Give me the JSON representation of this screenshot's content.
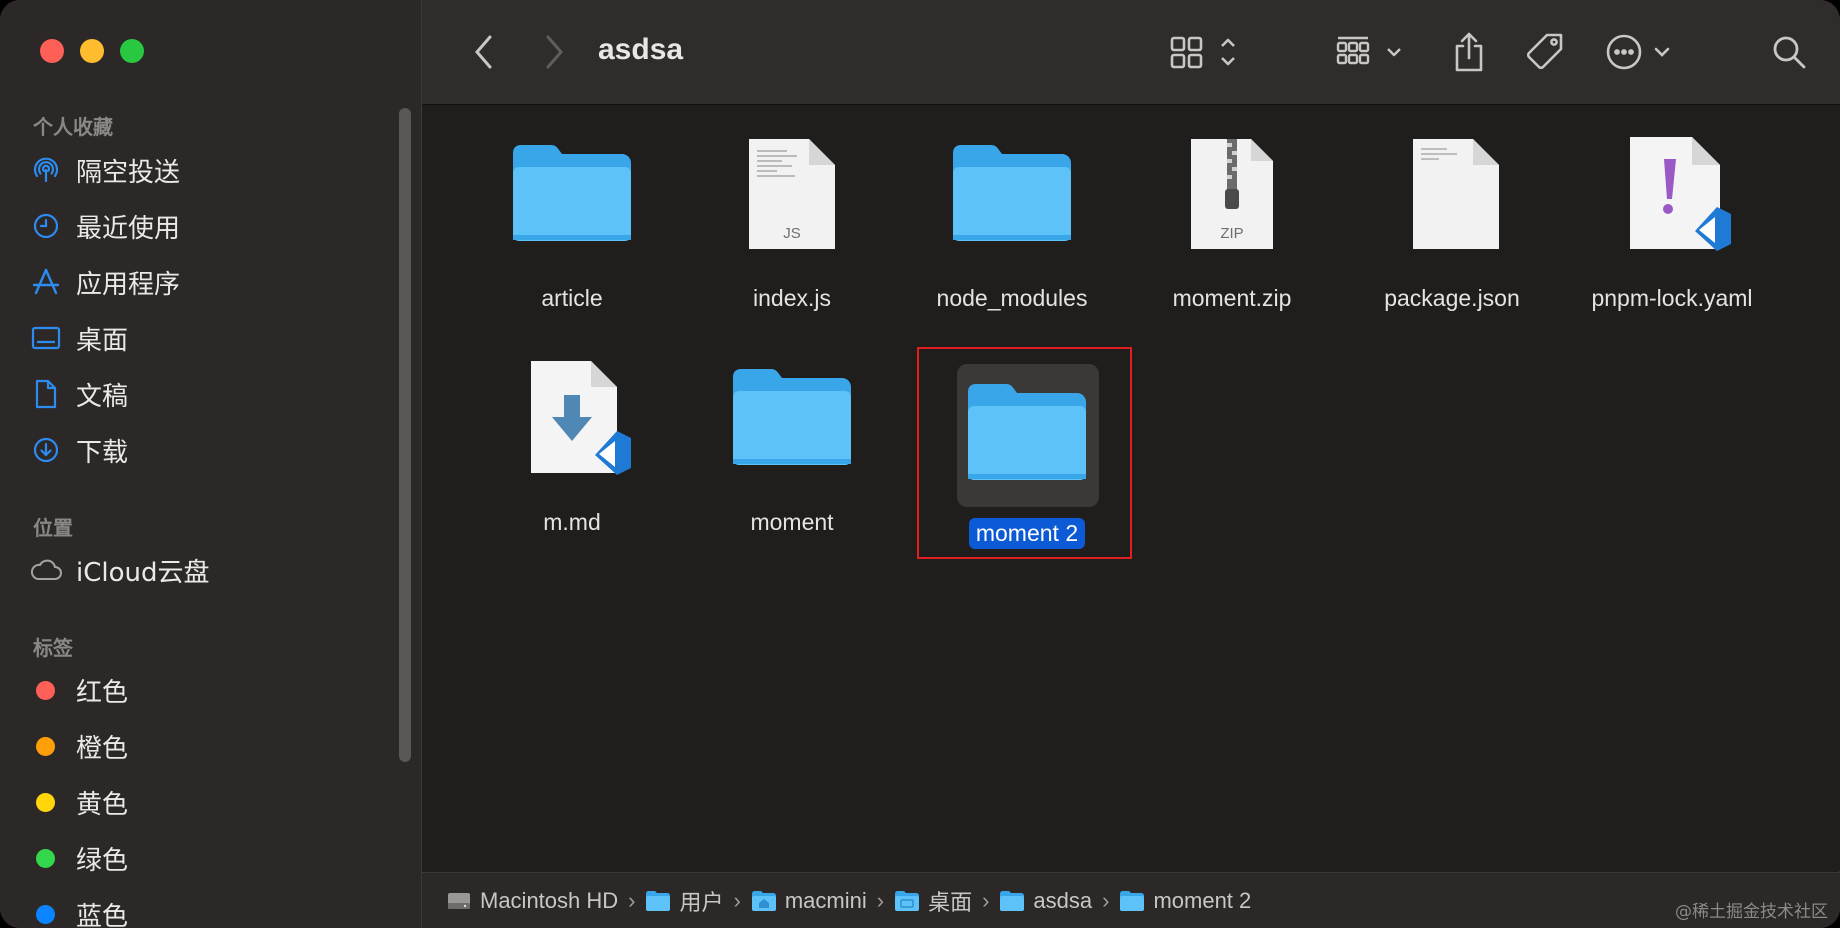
{
  "window": {
    "title": "asdsa"
  },
  "sidebar": {
    "sections": [
      {
        "title": "个人收藏",
        "items": [
          {
            "label": "隔空投送",
            "icon": "airdrop-icon"
          },
          {
            "label": "最近使用",
            "icon": "clock-icon"
          },
          {
            "label": "应用程序",
            "icon": "applications-icon"
          },
          {
            "label": "桌面",
            "icon": "desktop-icon"
          },
          {
            "label": "文稿",
            "icon": "document-icon"
          },
          {
            "label": "下载",
            "icon": "download-icon"
          }
        ]
      },
      {
        "title": "位置",
        "items": [
          {
            "label": "iCloud云盘",
            "icon": "cloud-icon"
          }
        ]
      },
      {
        "title": "标签",
        "items": [
          {
            "label": "红色",
            "color": "#fe5f57"
          },
          {
            "label": "橙色",
            "color": "#fe9f0a"
          },
          {
            "label": "黄色",
            "color": "#ffd60a"
          },
          {
            "label": "绿色",
            "color": "#32d74b"
          },
          {
            "label": "蓝色",
            "color": "#0a84ff"
          }
        ]
      }
    ]
  },
  "files": [
    {
      "name": "article",
      "type": "folder"
    },
    {
      "name": "index.js",
      "type": "doc",
      "badge": "JS"
    },
    {
      "name": "node_modules",
      "type": "folder"
    },
    {
      "name": "moment.zip",
      "type": "zip",
      "badge": "ZIP"
    },
    {
      "name": "package.json",
      "type": "doc",
      "badge": ""
    },
    {
      "name": "pnpm-lock.yaml",
      "type": "yaml"
    },
    {
      "name": "m.md",
      "type": "md"
    },
    {
      "name": "moment",
      "type": "folder"
    },
    {
      "name": "moment 2",
      "type": "folder",
      "selected": true
    }
  ],
  "pathbar": [
    {
      "label": "Macintosh HD",
      "icon": "hard-drive-icon"
    },
    {
      "label": "用户",
      "icon": "folder-icon"
    },
    {
      "label": "macmini",
      "icon": "home-folder-icon"
    },
    {
      "label": "桌面",
      "icon": "folder-icon"
    },
    {
      "label": "asdsa",
      "icon": "folder-icon"
    },
    {
      "label": "moment 2",
      "icon": "folder-icon"
    }
  ],
  "watermark": "@稀土掘金技术社区",
  "colors": {
    "accent": "#0d5ad6",
    "folder": "#5cc2f8",
    "highlight": "#e02020"
  }
}
